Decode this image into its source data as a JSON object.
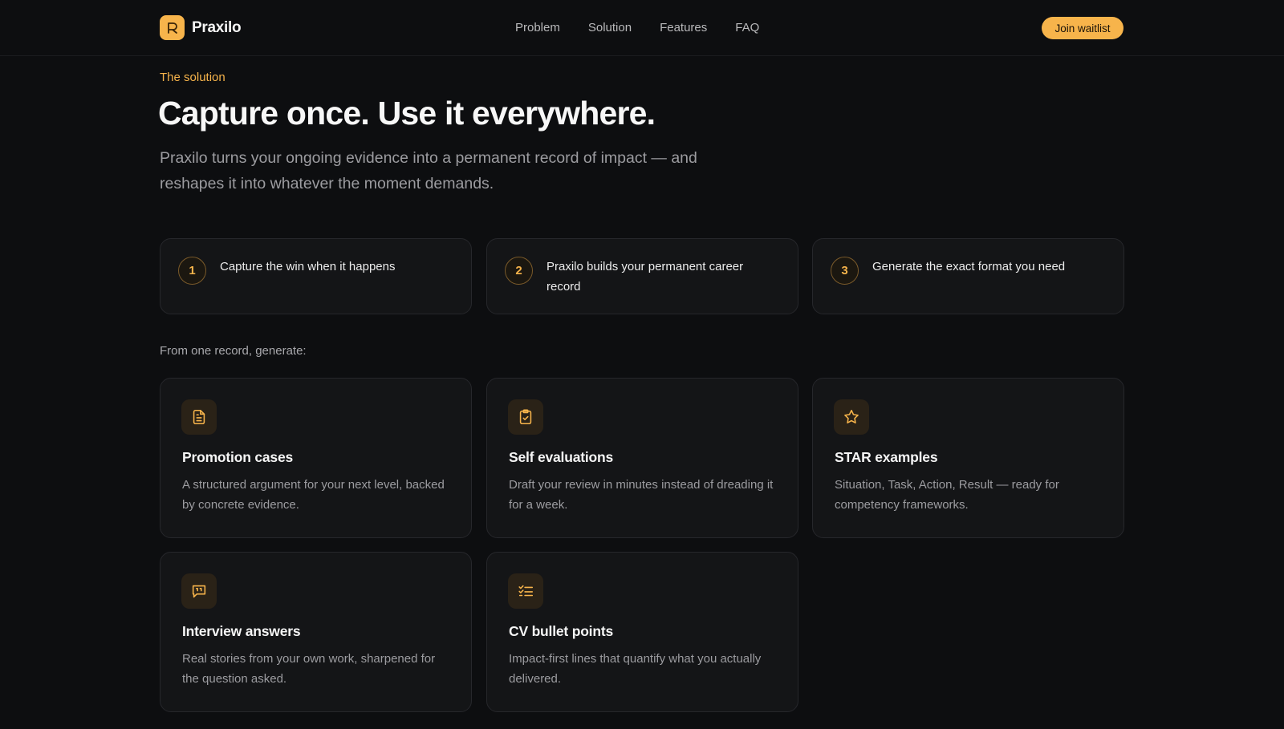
{
  "nav": {
    "brand": "Praxilo",
    "logo_letter": "R",
    "links": [
      "Problem",
      "Solution",
      "Features",
      "FAQ"
    ],
    "cta": "Join waitlist"
  },
  "hero": {
    "eyebrow": "The solution",
    "title": "Capture once. Use it everywhere.",
    "lead": "Praxilo turns your ongoing evidence into a permanent record of impact — and reshapes it into whatever the moment demands."
  },
  "steps": [
    {
      "num": "1",
      "text": "Capture the win when it happens"
    },
    {
      "num": "2",
      "text": "Praxilo builds your permanent career record"
    },
    {
      "num": "3",
      "text": "Generate the exact format you need"
    }
  ],
  "outputs": {
    "heading": "From one record, generate:",
    "cards": [
      {
        "icon": "document-icon",
        "title": "Promotion cases",
        "desc": "A structured argument for your next level, backed by concrete evidence."
      },
      {
        "icon": "clipboard-check-icon",
        "title": "Self evaluations",
        "desc": "Draft your review in minutes instead of dreading it for a week."
      },
      {
        "icon": "star-icon",
        "title": "STAR examples",
        "desc": "Situation, Task, Action, Result — ready for competency frameworks."
      },
      {
        "icon": "quote-bubble-icon",
        "title": "Interview answers",
        "desc": "Real stories from your own work, sharpened for the question asked."
      },
      {
        "icon": "checklist-icon",
        "title": "CV bullet points",
        "desc": "Impact-first lines that quantify what you actually delivered."
      }
    ]
  },
  "colors": {
    "accent": "#f7b44b",
    "background": "#0d0e10",
    "card": "#141517",
    "border": "#26272b"
  }
}
